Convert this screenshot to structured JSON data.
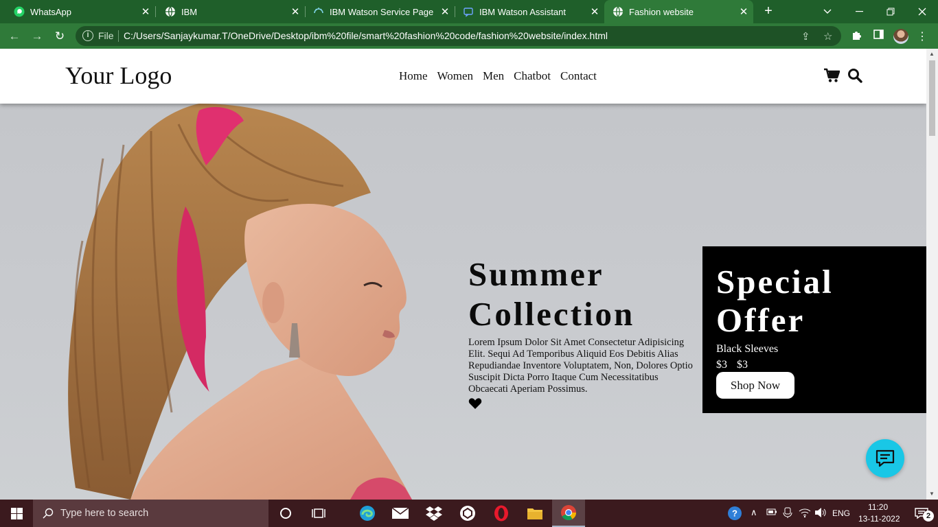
{
  "browser": {
    "tabs": [
      {
        "title": "WhatsApp",
        "icon": "whatsapp-icon"
      },
      {
        "title": "IBM",
        "icon": "globe-icon"
      },
      {
        "title": "IBM Watson Service Page",
        "icon": "watson-icon"
      },
      {
        "title": "IBM Watson Assistant",
        "icon": "assistant-icon"
      },
      {
        "title": "Fashion website",
        "icon": "globe-icon",
        "active": true
      }
    ],
    "address": {
      "scheme_label": "File",
      "url": "C:/Users/Sanjaykumar.T/OneDrive/Desktop/ibm%20file/smart%20fashion%20code/fashion%20website/index.html"
    }
  },
  "site": {
    "logo": "Your Logo",
    "nav": [
      "Home",
      "Women",
      "Men",
      "Chatbot",
      "Contact"
    ],
    "hero": {
      "title_line1": "Summer",
      "title_line2": "Collection",
      "description": "Lorem Ipsum Dolor Sit Amet Consectetur Adipisicing Elit. Sequi Ad Temporibus Aliquid Eos Debitis Alias Repudiandae Inventore Voluptatem, Non, Dolores Optio Suscipit Dicta Porro Itaque Cum Necessitatibus Obcaecati Aperiam Possimus."
    },
    "offer": {
      "title_line1": "Special",
      "title_line2": "Offer",
      "product": "Black Sleeves",
      "price_1": "$3",
      "price_2": "$3",
      "button": "Shop Now"
    }
  },
  "taskbar": {
    "search_placeholder": "Type here to search",
    "language": "ENG",
    "time": "11:20",
    "date": "13-11-2022",
    "notification_count": "2"
  },
  "colors": {
    "browser_frame": "#1f5f2a",
    "browser_toolbar": "#2f7a39",
    "offer_background": "#000000",
    "chat_button": "#19c7e6",
    "taskbar": "#3b1a1e"
  }
}
